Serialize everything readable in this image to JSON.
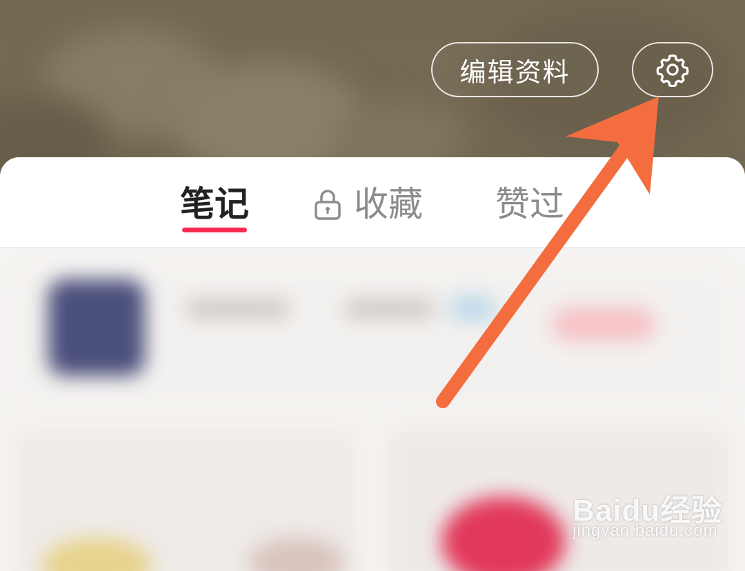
{
  "header": {
    "edit_profile_label": "编辑资料",
    "settings_icon": "gear-icon"
  },
  "tabs": [
    {
      "label": "笔记",
      "active": true
    },
    {
      "label": "收藏",
      "icon": "lock-icon",
      "active": false
    },
    {
      "label": "赞过",
      "active": false
    }
  ],
  "watermark": {
    "logo": "Baidu经验",
    "url": "jingyan.baidu.com"
  },
  "colors": {
    "accent": "#ff2a4f",
    "arrow": "#f36d3f",
    "header_bg": "#736851"
  }
}
